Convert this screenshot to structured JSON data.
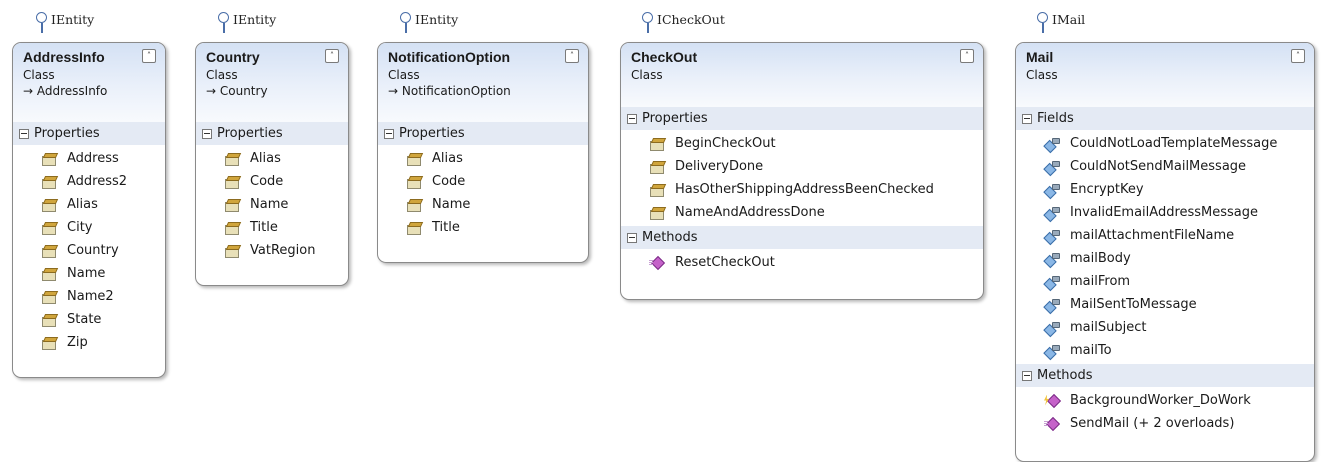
{
  "interfaces": {
    "addressinfo": "IEntity",
    "country": "IEntity",
    "notificationoption": "IEntity",
    "checkout": "ICheckOut",
    "mail": "IMail"
  },
  "classes": {
    "addressinfo": {
      "name": "AddressInfo",
      "kind": "Class",
      "base": "→ AddressInfo",
      "sections": [
        {
          "title": "Properties",
          "icon": "property-icon",
          "items": [
            "Address",
            "Address2",
            "Alias",
            "City",
            "Country",
            "Name",
            "Name2",
            "State",
            "Zip"
          ]
        }
      ]
    },
    "country": {
      "name": "Country",
      "kind": "Class",
      "base": "→ Country",
      "sections": [
        {
          "title": "Properties",
          "icon": "property-icon",
          "items": [
            "Alias",
            "Code",
            "Name",
            "Title",
            "VatRegion"
          ]
        }
      ]
    },
    "notificationoption": {
      "name": "NotificationOption",
      "kind": "Class",
      "base": "→ NotificationOption",
      "sections": [
        {
          "title": "Properties",
          "icon": "property-icon",
          "items": [
            "Alias",
            "Code",
            "Name",
            "Title"
          ]
        }
      ]
    },
    "checkout": {
      "name": "CheckOut",
      "kind": "Class",
      "sections": [
        {
          "title": "Properties",
          "icon": "property-icon",
          "items": [
            "BeginCheckOut",
            "DeliveryDone",
            "HasOtherShippingAddressBeenChecked",
            "NameAndAddressDone"
          ]
        },
        {
          "title": "Methods",
          "icon": "method-icon",
          "items": [
            "ResetCheckOut"
          ]
        }
      ]
    },
    "mail": {
      "name": "Mail",
      "kind": "Class",
      "sections": [
        {
          "title": "Fields",
          "icon": "field-icon",
          "items": [
            "CouldNotLoadTemplateMessage",
            "CouldNotSendMailMessage",
            "EncryptKey",
            "InvalidEmailAddressMessage",
            "mailAttachmentFileName",
            "mailBody",
            "mailFrom",
            "MailSentToMessage",
            "mailSubject",
            "mailTo"
          ]
        },
        {
          "title": "Methods",
          "icon": "method-icon",
          "items": [
            "BackgroundWorker_DoWork",
            "SendMail (+ 2 overloads)"
          ],
          "item_icons": [
            "event-handler-icon",
            "method-icon"
          ]
        }
      ]
    }
  },
  "icons": {
    "collapse": "chevron-double-up-icon",
    "section_toggle": "minus-box-icon",
    "interface_lollipop": "interface-lollipop-icon"
  }
}
